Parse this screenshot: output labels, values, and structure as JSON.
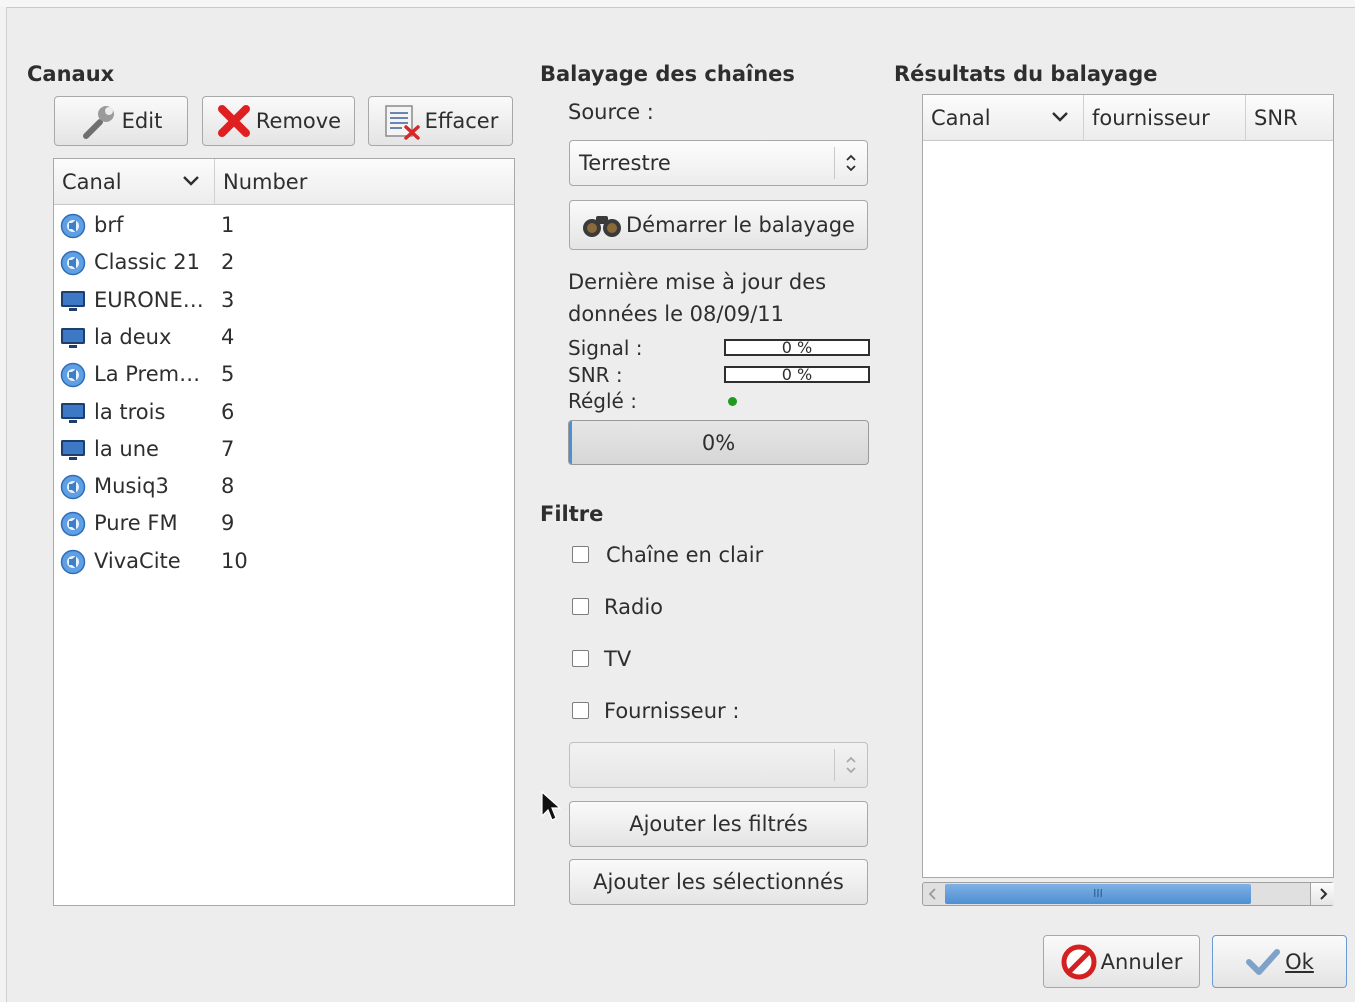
{
  "canaux": {
    "title": "Canaux",
    "edit_label": "Edit",
    "remove_label": "Remove",
    "clear_label": "Effacer",
    "col_canal": "Canal",
    "col_number": "Number",
    "rows": [
      {
        "name": "brf",
        "number": "1",
        "icon": "radio-icon"
      },
      {
        "name": "Classic 21",
        "number": "2",
        "icon": "radio-icon"
      },
      {
        "name": "EURONE…",
        "number": "3",
        "icon": "tv-icon"
      },
      {
        "name": "la deux",
        "number": "4",
        "icon": "tv-icon"
      },
      {
        "name": "La Prem…",
        "number": "5",
        "icon": "radio-icon"
      },
      {
        "name": "la trois",
        "number": "6",
        "icon": "tv-icon"
      },
      {
        "name": "la une",
        "number": "7",
        "icon": "tv-icon"
      },
      {
        "name": "Musiq3",
        "number": "8",
        "icon": "radio-icon"
      },
      {
        "name": "Pure FM",
        "number": "9",
        "icon": "radio-icon"
      },
      {
        "name": "VivaCite",
        "number": "10",
        "icon": "radio-icon"
      }
    ]
  },
  "scan": {
    "title": "Balayage des chaînes",
    "source_label": "Source :",
    "source_value": "Terrestre",
    "start_label": "Démarrer le balayage",
    "last_update_line1": "Dernière mise à jour des",
    "last_update_line2": "données le 08/09/11",
    "signal_label": "Signal :",
    "signal_value": "0 %",
    "snr_label": "SNR :",
    "snr_value": "0 %",
    "tuned_label": "Réglé :",
    "progress_text": "0%",
    "progress_fraction": 0.01
  },
  "filter": {
    "title": "Filtre",
    "clear_channel": "Chaîne en clair",
    "radio": "Radio",
    "tv": "TV",
    "provider": "Fournisseur :",
    "provider_value": "",
    "add_filtered": "Ajouter les filtrés",
    "add_selected": "Ajouter les sélectionnés"
  },
  "results": {
    "title": "Résultats du balayage",
    "col_canal": "Canal",
    "col_provider": "fournisseur",
    "col_snr": "SNR",
    "scroll_glyph": "III"
  },
  "footer": {
    "cancel_label": "Annuler",
    "ok_label": "Ok"
  },
  "colors": {
    "accent": "#4a90d9",
    "tuned_indicator": "#1f9a1f",
    "remove_red": "#e02020",
    "cancel_red": "#d42020"
  }
}
